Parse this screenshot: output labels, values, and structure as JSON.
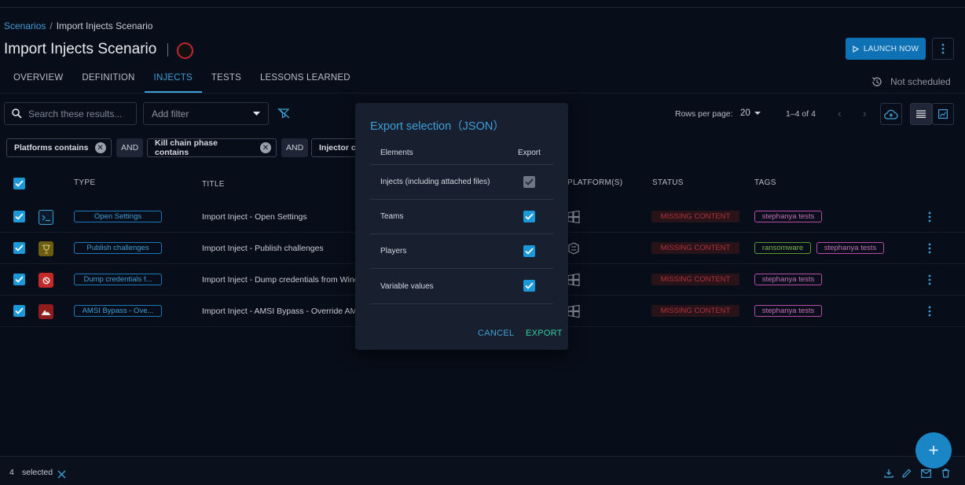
{
  "breadcrumb": {
    "root": "Scenarios",
    "separator": "/",
    "current": "Import Injects Scenario"
  },
  "page": {
    "title": "Import Injects Scenario",
    "launch_label": "LAUNCH NOW",
    "schedule_status": "Not scheduled"
  },
  "tabs": [
    {
      "label": "OVERVIEW",
      "active": false
    },
    {
      "label": "DEFINITION",
      "active": false
    },
    {
      "label": "INJECTS",
      "active": true
    },
    {
      "label": "TESTS",
      "active": false
    },
    {
      "label": "LESSONS LEARNED",
      "active": false
    }
  ],
  "toolbar": {
    "search_placeholder": "Search these results...",
    "add_filter_label": "Add filter",
    "rows_per_page_label": "Rows per page:",
    "rows_per_page_value": "20",
    "range_label": "1–4 of 4"
  },
  "filters": [
    {
      "label": "Platforms contains"
    },
    {
      "label": "Kill chain phase contains"
    },
    {
      "label": "Injector c"
    }
  ],
  "filter_operator": "AND",
  "table": {
    "columns": {
      "type": "TYPE",
      "title": "TITLE",
      "platforms": "PLATFORM(S)",
      "status": "STATUS",
      "tags": "TAGS"
    },
    "rows": [
      {
        "type": "Open Settings",
        "title": "Import Inject - Open Settings",
        "status": "MISSING CONTENT",
        "tags": [
          "stephanya tests"
        ]
      },
      {
        "type": "Publish challenges",
        "title": "Import Inject - Publish challenges",
        "status": "MISSING CONTENT",
        "tags": [
          "ransomware",
          "stephanya tests"
        ]
      },
      {
        "type": "Dump credentials f...",
        "title": "Import Inject - Dump credentials from Windows",
        "status": "MISSING CONTENT",
        "tags": [
          "stephanya tests"
        ]
      },
      {
        "type": "AMSI Bypass - Ove...",
        "title": "Import Inject - AMSI Bypass - Override AMSI",
        "status": "MISSING CONTENT",
        "tags": [
          "stephanya tests"
        ]
      }
    ]
  },
  "dialog": {
    "title": "Export selection（JSON）",
    "col_elements": "Elements",
    "col_export": "Export",
    "items": [
      {
        "label": "Injects (including attached files)",
        "checked": true,
        "disabled": true
      },
      {
        "label": "Teams",
        "checked": true,
        "disabled": false
      },
      {
        "label": "Players",
        "checked": true,
        "disabled": false
      },
      {
        "label": "Variable values",
        "checked": true,
        "disabled": false
      }
    ],
    "cancel_label": "CANCEL",
    "export_label": "EXPORT"
  },
  "selection": {
    "count": "4",
    "label": "selected"
  },
  "colors": {
    "accent": "#3e9fd6",
    "checkbox": "#1b98d8",
    "missing": "#b3323d",
    "export": "#2fcf9d"
  }
}
